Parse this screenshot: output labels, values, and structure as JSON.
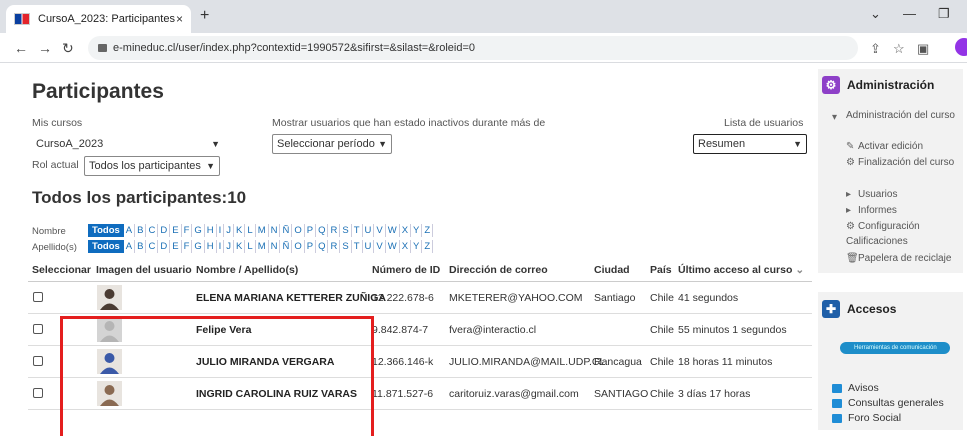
{
  "browser": {
    "tab_title": "CursoA_2023: Participantes",
    "tab_close": "×",
    "new_tab": "+",
    "url": "e-mineduc.cl/user/index.php?contextid=1990572&sifirst=&silast=&roleid=0"
  },
  "page": {
    "title": "Participantes",
    "my_courses_label": "Mis cursos",
    "course_value": "CursoA_2023",
    "inactive_label": "Mostrar usuarios que han estado inactivos durante más de",
    "period_value": "Seleccionar período",
    "user_list_label": "Lista de usuarios",
    "user_list_value": "Resumen",
    "role_label": "Rol actual",
    "role_value": "Todos los participantes",
    "count_title": "Todos los participantes:10",
    "first_name_label": "Nombre",
    "last_name_label": "Apellido(s)",
    "all_label": "Todos",
    "letters": [
      "A",
      "B",
      "C",
      "D",
      "E",
      "F",
      "G",
      "H",
      "I",
      "J",
      "K",
      "L",
      "M",
      "N",
      "Ñ",
      "O",
      "P",
      "Q",
      "R",
      "S",
      "T",
      "U",
      "V",
      "W",
      "X",
      "Y",
      "Z"
    ]
  },
  "table": {
    "headers": [
      "Seleccionar",
      "Imagen del usuario",
      "Nombre / Apellido(s)",
      "Número de ID",
      "Dirección de correo",
      "Ciudad",
      "País",
      "Último acceso al curso"
    ],
    "rows": [
      {
        "name": "ELENA MARIANA KETTERER ZUÑIGA",
        "id": "12.222.678-6",
        "email": "MKETERER@YAHOO.COM",
        "city": "Santiago",
        "country": "Chile",
        "last": "41 segundos"
      },
      {
        "name": "Felipe Vera",
        "id": "9.842.874-7",
        "email": "fvera@interactio.cl",
        "city": "",
        "country": "Chile",
        "last": "55 minutos 1 segundos"
      },
      {
        "name": "JULIO MIRANDA VERGARA",
        "id": "12.366.146-k",
        "email": "JULIO.MIRANDA@MAIL.UDP.CL",
        "city": "Rancagua",
        "country": "Chile",
        "last": "18 horas 11 minutos"
      },
      {
        "name": "INGRID CAROLINA RUIZ VARAS",
        "id": "11.871.527-6",
        "email": "caritoruiz.varas@gmail.com",
        "city": "SANTIAGO",
        "country": "Chile",
        "last": "3 días 17 horas"
      }
    ]
  },
  "admin": {
    "title": "Administración",
    "course_admin": "Administración del curso",
    "items": [
      "Activar edición",
      "Finalización del curso",
      "Usuarios",
      "Informes",
      "Configuración Calificaciones",
      "Papelera de reciclaje"
    ]
  },
  "access": {
    "title": "Accesos",
    "pill": "Herramientas de comunicación",
    "items": [
      "Avisos",
      "Consultas generales",
      "Foro Social"
    ]
  }
}
